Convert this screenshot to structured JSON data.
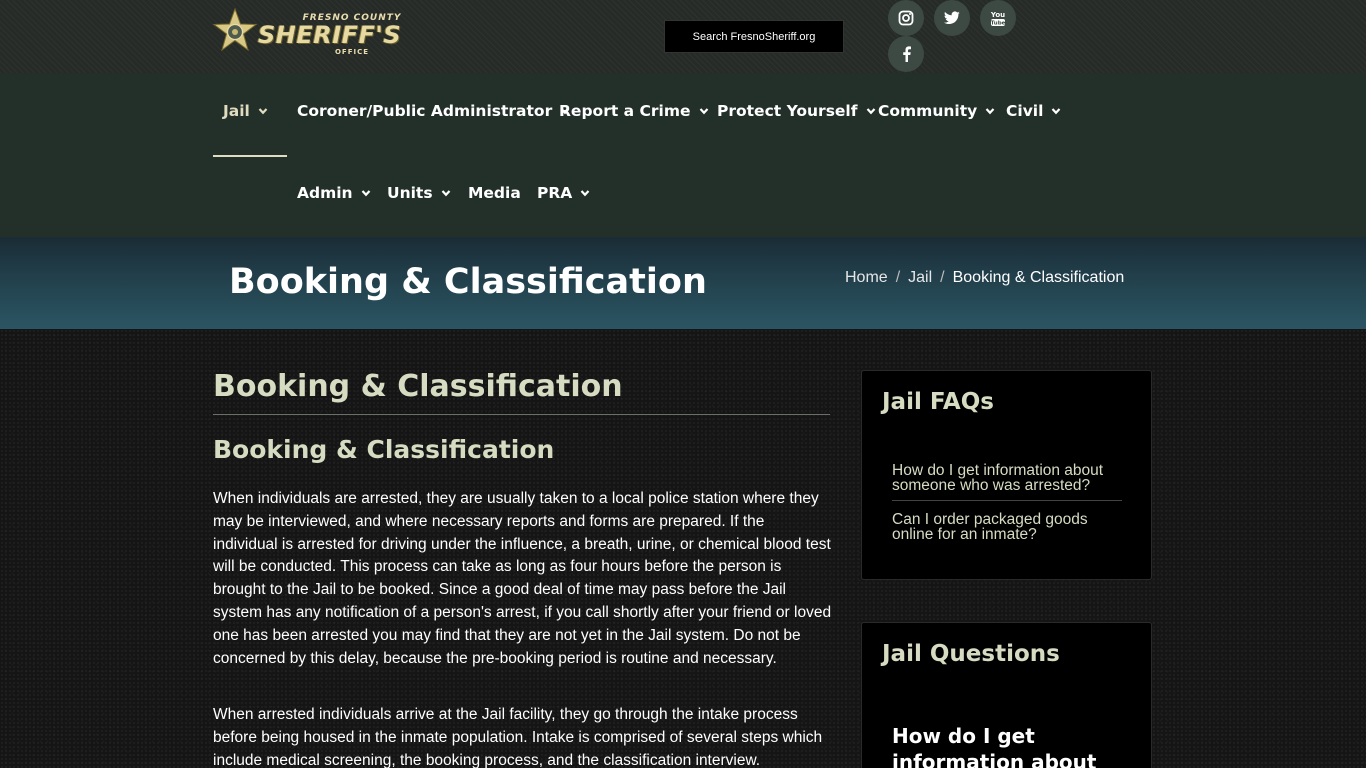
{
  "logo": {
    "small_text": "FRESNO COUNTY",
    "big_text": "SHERIFF'S",
    "office_text": "OFFICE",
    "star_icon": "sheriff-star-icon"
  },
  "search": {
    "label": "Search FresnoSheriff.org"
  },
  "social": {
    "instagram_icon": "instagram-icon",
    "twitter_icon": "twitter-icon",
    "youtube_icon": "youtube-icon",
    "facebook_icon": "facebook-icon"
  },
  "nav": {
    "items": [
      {
        "label": "Jail",
        "has_dropdown": true,
        "active": true
      },
      {
        "label": "Coroner/Public Administrator",
        "has_dropdown": true
      },
      {
        "label": "Report a Crime",
        "has_dropdown": true
      },
      {
        "label": "Protect Yourself",
        "has_dropdown": true
      },
      {
        "label": "Community",
        "has_dropdown": true
      },
      {
        "label": "Civil",
        "has_dropdown": true
      },
      {
        "label": "Admin",
        "has_dropdown": true
      },
      {
        "label": "Units",
        "has_dropdown": true
      },
      {
        "label": "Media",
        "has_dropdown": false
      },
      {
        "label": "PRA",
        "has_dropdown": true
      }
    ]
  },
  "hero": {
    "title": "Booking & Classification",
    "breadcrumb": [
      {
        "label": "Home"
      },
      {
        "label": "Jail"
      },
      {
        "label": "Booking & Classification"
      }
    ]
  },
  "main": {
    "heading": "Booking & Classification",
    "subheading": "Booking & Classification",
    "paragraphs": [
      "When individuals are arrested, they are usually taken to a local police station where they may be interviewed, and where necessary reports and forms are prepared. If the individual is arrested for driving under the influence, a breath, urine, or chemical blood test will be conducted. This process can take as long as four hours before the person is brought to the Jail to be booked. Since a good deal of time may pass before the Jail system has any notification of a person's arrest, if you call shortly after your friend or loved one has been arrested you may find that they are not yet in the Jail system. Do not be concerned by this delay, because the pre-booking period is routine and necessary.",
      "When arrested individuals arrive at the Jail facility, they go through the intake process before being housed in the inmate population. Intake is comprised of several steps which include medical screening, the booking process, and the classification interview."
    ]
  },
  "sidebar": {
    "faqs": {
      "title": "Jail FAQs",
      "links": [
        "How do I get information about someone who was arrested?",
        "Can I order packaged goods online for an inmate?"
      ]
    },
    "questions": {
      "title": "Jail Questions",
      "first_question": "How do I get information about"
    }
  },
  "colors": {
    "topbar": "#262b27",
    "nav": "#233029",
    "accent": "#d6dcc2",
    "hero_dark": "#1a2c36",
    "hero_light": "#2b5563"
  }
}
